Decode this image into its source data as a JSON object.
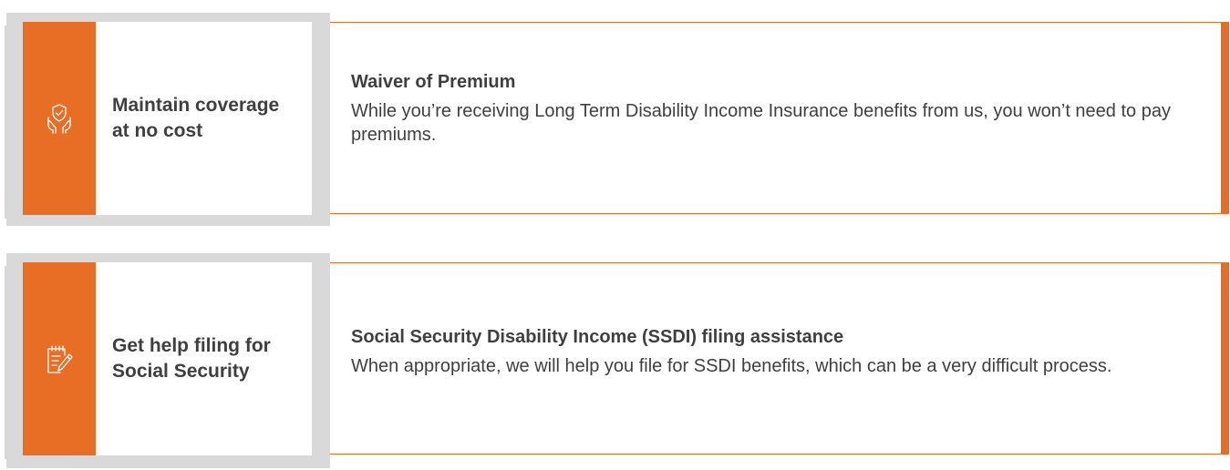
{
  "colors": {
    "accent": "#e86e25",
    "panel_gray": "#d9d9d9",
    "text": "#3f3f3f"
  },
  "benefits": [
    {
      "icon": "hands-shield-icon",
      "card_title": "Maintain coverage at no cost",
      "heading": "Waiver of Premium",
      "description": "While you’re receiving Long Term Disability Income Insurance benefits from us, you won’t need to pay premiums."
    },
    {
      "icon": "notepad-pencil-icon",
      "card_title": "Get help filing for Social Security",
      "heading": "Social Security Disability Income (SSDI) filing assistance",
      "description": "When appropriate, we will help you file for SSDI benefits, which can be a very difficult process."
    }
  ]
}
